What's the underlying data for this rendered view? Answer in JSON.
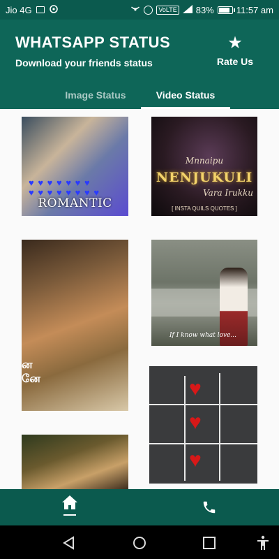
{
  "status_bar": {
    "carrier": "Jio 4G",
    "volte": "VoLTE",
    "battery": "83%",
    "battery_level": 0.83,
    "time": "11:57 am"
  },
  "header": {
    "title": "WHATSAPP STATUS",
    "subtitle": "Download your friends status",
    "rate_label": "Rate Us",
    "rate_icon": "star-icon"
  },
  "tabs": [
    {
      "label": "Image Status",
      "active": false
    },
    {
      "label": "Video Status",
      "active": true
    }
  ],
  "thumbnails": {
    "t1": {
      "caption": "ROMANTIC"
    },
    "t2": {
      "line1": "Mnnaipu",
      "title": "NENJUKULI",
      "line2": "Vara Irukku",
      "credit": "[ INSTA QUILS QUOTES ]"
    },
    "t3": {
      "tamil_text": "ன\nனே"
    },
    "t4": {
      "caption": "If I know what love..."
    },
    "t5": {},
    "t6": {}
  },
  "bottom_nav": {
    "home_icon": "home-icon",
    "call_icon": "phone-icon"
  },
  "colors": {
    "primary": "#0e6658",
    "primary_dark": "#0b5a4e",
    "accent": "#ffffff"
  }
}
